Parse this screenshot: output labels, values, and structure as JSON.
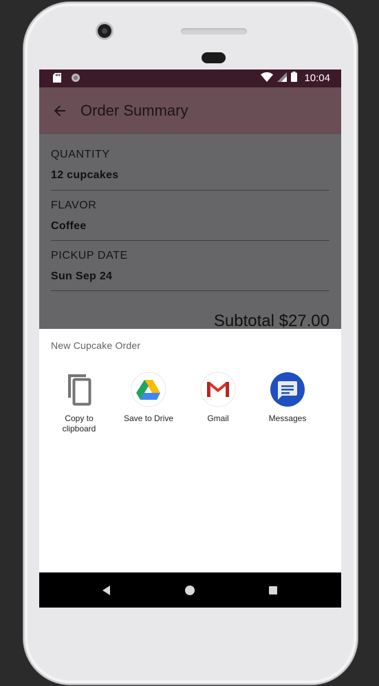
{
  "status_bar": {
    "time": "10:04"
  },
  "app_bar": {
    "title": "Order Summary"
  },
  "summary": {
    "quantity": {
      "label": "QUANTITY",
      "value": "12 cupcakes"
    },
    "flavor": {
      "label": "FLAVOR",
      "value": "Coffee"
    },
    "pickup": {
      "label": "PICKUP DATE",
      "value": "Sun Sep 24"
    },
    "subtotal": "Subtotal $27.00"
  },
  "share_sheet": {
    "title": "New Cupcake Order",
    "targets": [
      {
        "label": "Copy to clipboard",
        "icon": "copy-icon"
      },
      {
        "label": "Save to Drive",
        "icon": "google-drive-icon"
      },
      {
        "label": "Gmail",
        "icon": "gmail-icon"
      },
      {
        "label": "Messages",
        "icon": "messages-icon"
      }
    ]
  },
  "colors": {
    "status_bar": "#3c1a29",
    "app_bar_scrim": "#694e55",
    "content_scrim": "#666668",
    "messages_blue": "#1f4fc1"
  }
}
